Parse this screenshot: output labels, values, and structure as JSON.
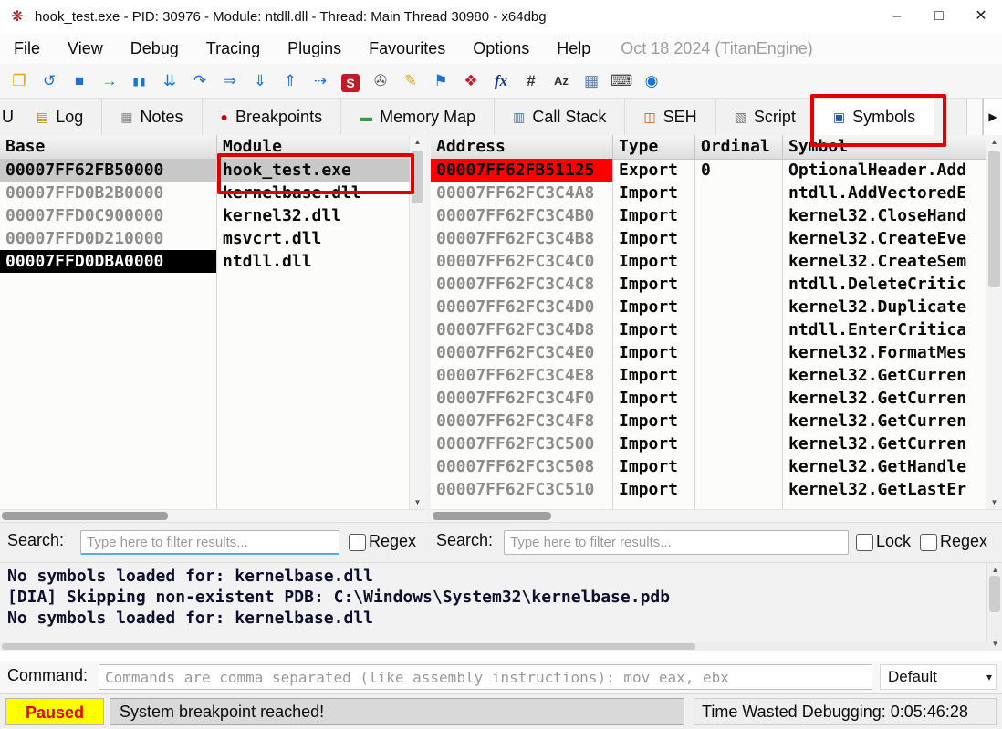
{
  "window": {
    "title": "hook_test.exe - PID: 30976 - Module: ntdll.dll - Thread: Main Thread 30980 - x64dbg",
    "app_icon_glyph": "❋",
    "controls": {
      "minimize": "–",
      "maximize": "□",
      "close": "✕"
    }
  },
  "menu": {
    "items": [
      "File",
      "View",
      "Debug",
      "Tracing",
      "Plugins",
      "Favourites",
      "Options",
      "Help"
    ],
    "build_info": "Oct 18 2024 (TitanEngine)"
  },
  "toolbar": {
    "icons": [
      {
        "name": "open-file-icon",
        "glyph": "❐"
      },
      {
        "name": "restart-icon",
        "glyph": "↺"
      },
      {
        "name": "stop-icon",
        "glyph": "■"
      },
      {
        "name": "run-icon",
        "glyph": "→"
      },
      {
        "name": "pause-icon",
        "glyph": "▮▮"
      },
      {
        "name": "step-into-icon",
        "glyph": "⇊"
      },
      {
        "name": "step-over-icon",
        "glyph": "↷"
      },
      {
        "name": "execute-till-return-icon",
        "glyph": "⇒"
      },
      {
        "name": "run-to-user-code-icon",
        "glyph": "⇓"
      },
      {
        "name": "step-out-icon",
        "glyph": "⇑"
      },
      {
        "name": "animate-into-icon",
        "glyph": "⇢"
      },
      {
        "name": "source-icon",
        "glyph": "S"
      },
      {
        "name": "patches-icon",
        "glyph": "✇"
      },
      {
        "name": "comments-icon",
        "glyph": "✎"
      },
      {
        "name": "labels-icon",
        "glyph": "⚑"
      },
      {
        "name": "bookmarks-icon",
        "glyph": "❖"
      },
      {
        "name": "functions-icon",
        "glyph": "fx"
      },
      {
        "name": "crash-dump-icon",
        "glyph": "#"
      },
      {
        "name": "strings-icon",
        "glyph": "Az"
      },
      {
        "name": "memory-icon",
        "glyph": "▦"
      },
      {
        "name": "calculator-icon",
        "glyph": "⌨"
      },
      {
        "name": "about-icon",
        "glyph": "◉"
      }
    ]
  },
  "tabs": {
    "overflow_left_label": "U",
    "active": "Symbols",
    "scroll_right_glyph": "▶",
    "items": [
      {
        "name": "tab-log",
        "label": "Log",
        "glyph": "▤"
      },
      {
        "name": "tab-notes",
        "label": "Notes",
        "glyph": "▦"
      },
      {
        "name": "tab-breakpoints",
        "label": "Breakpoints",
        "glyph": "●"
      },
      {
        "name": "tab-memory-map",
        "label": "Memory Map",
        "glyph": "▬"
      },
      {
        "name": "tab-call-stack",
        "label": "Call Stack",
        "glyph": "▥"
      },
      {
        "name": "tab-seh",
        "label": "SEH",
        "glyph": "◫"
      },
      {
        "name": "tab-script",
        "label": "Script",
        "glyph": "▧"
      },
      {
        "name": "tab-symbols",
        "label": "Symbols",
        "glyph": "▣"
      }
    ]
  },
  "modules_panel": {
    "columns": [
      "Base",
      "Module"
    ],
    "rows": [
      {
        "base": "00007FF62FB50000",
        "module": "hook_test.exe",
        "selected": true,
        "annotated": true,
        "base_highlight": false
      },
      {
        "base": "00007FFD0B2B0000",
        "module": "kernelbase.dll",
        "selected": false,
        "annotated": false,
        "base_highlight": false
      },
      {
        "base": "00007FFD0C900000",
        "module": "kernel32.dll",
        "selected": false,
        "annotated": false,
        "base_highlight": false
      },
      {
        "base": "00007FFD0D210000",
        "module": "msvcrt.dll",
        "selected": false,
        "annotated": false,
        "base_highlight": false
      },
      {
        "base": "00007FFD0DBA0000",
        "module": "ntdll.dll",
        "selected": false,
        "annotated": false,
        "base_highlight": true
      }
    ]
  },
  "symbols_panel": {
    "columns": [
      "Address",
      "Type",
      "Ordinal",
      "Symbol"
    ],
    "rows": [
      {
        "address": "00007FF62FB51125",
        "type": "Export",
        "ordinal": "0",
        "symbol": "OptionalHeader.Add",
        "selected": true
      },
      {
        "address": "00007FF62FC3C4A8",
        "type": "Import",
        "ordinal": "",
        "symbol": "ntdll.AddVectoredE",
        "selected": false
      },
      {
        "address": "00007FF62FC3C4B0",
        "type": "Import",
        "ordinal": "",
        "symbol": "kernel32.CloseHand",
        "selected": false
      },
      {
        "address": "00007FF62FC3C4B8",
        "type": "Import",
        "ordinal": "",
        "symbol": "kernel32.CreateEve",
        "selected": false
      },
      {
        "address": "00007FF62FC3C4C0",
        "type": "Import",
        "ordinal": "",
        "symbol": "kernel32.CreateSem",
        "selected": false
      },
      {
        "address": "00007FF62FC3C4C8",
        "type": "Import",
        "ordinal": "",
        "symbol": "ntdll.DeleteCritic",
        "selected": false
      },
      {
        "address": "00007FF62FC3C4D0",
        "type": "Import",
        "ordinal": "",
        "symbol": "kernel32.Duplicate",
        "selected": false
      },
      {
        "address": "00007FF62FC3C4D8",
        "type": "Import",
        "ordinal": "",
        "symbol": "ntdll.EnterCritica",
        "selected": false
      },
      {
        "address": "00007FF62FC3C4E0",
        "type": "Import",
        "ordinal": "",
        "symbol": "kernel32.FormatMes",
        "selected": false
      },
      {
        "address": "00007FF62FC3C4E8",
        "type": "Import",
        "ordinal": "",
        "symbol": "kernel32.GetCurren",
        "selected": false
      },
      {
        "address": "00007FF62FC3C4F0",
        "type": "Import",
        "ordinal": "",
        "symbol": "kernel32.GetCurren",
        "selected": false
      },
      {
        "address": "00007FF62FC3C4F8",
        "type": "Import",
        "ordinal": "",
        "symbol": "kernel32.GetCurren",
        "selected": false
      },
      {
        "address": "00007FF62FC3C500",
        "type": "Import",
        "ordinal": "",
        "symbol": "kernel32.GetCurren",
        "selected": false
      },
      {
        "address": "00007FF62FC3C508",
        "type": "Import",
        "ordinal": "",
        "symbol": "kernel32.GetHandle",
        "selected": false
      },
      {
        "address": "00007FF62FC3C510",
        "type": "Import",
        "ordinal": "",
        "symbol": "kernel32.GetLastEr",
        "selected": false
      }
    ]
  },
  "scrollbar": {
    "up": "▲",
    "down": "▼"
  },
  "filters": {
    "left": {
      "label": "Search:",
      "placeholder": "Type here to filter results...",
      "regex_label": "Regex"
    },
    "right": {
      "label": "Search:",
      "placeholder": "Type here to filter results...",
      "lock_label": "Lock",
      "regex_label": "Regex"
    }
  },
  "log": {
    "lines": [
      "No symbols loaded for: kernelbase.dll",
      "[DIA] Skipping non-existent PDB: C:\\Windows\\System32\\kernelbase.pdb",
      "No symbols loaded for: kernelbase.dll"
    ]
  },
  "command": {
    "label": "Command:",
    "placeholder": "Commands are comma separated (like assembly instructions): mov eax, ebx",
    "dropdown_value": "Default",
    "dropdown_caret": "▾"
  },
  "statusbar": {
    "state": "Paused",
    "message": "System breakpoint reached!",
    "time_wasted": "Time Wasted Debugging: 0:05:46:28"
  },
  "colors": {
    "selection_red": "#ff0000",
    "row_selected": "#c8c8c8",
    "base_highlight_bg": "#000000",
    "base_highlight_text": "#ffffff",
    "annotation_red": "#e10000",
    "paused_bg": "#ffff00",
    "paused_text": "#e60000",
    "address_gray": "#8c8c8c",
    "accent_blue": "#1c71d8"
  }
}
